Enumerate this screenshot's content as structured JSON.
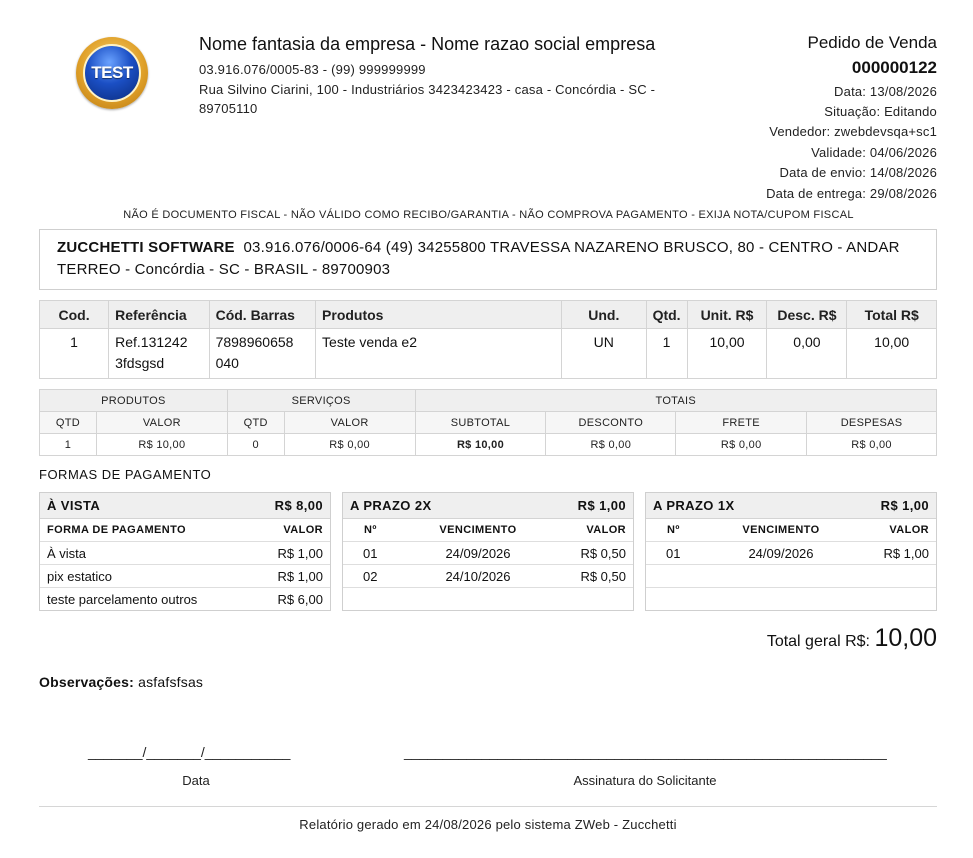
{
  "company": {
    "logo_text": "TEST",
    "name": "Nome fantasia da empresa - Nome razao social empresa",
    "doc_phone": "03.916.076/0005-83 - (99) 999999999",
    "address": "Rua Silvino Ciarini, 100 - Industriários 3423423423 - casa - Concórdia - SC - 89705110"
  },
  "order": {
    "title": "Pedido de Venda",
    "number": "000000122",
    "data": "Data: 13/08/2026",
    "situacao": "Situação: Editando",
    "vendedor": "Vendedor: zwebdevsqa+sc1",
    "validade": "Validade: 04/06/2026",
    "envio": "Data de envio: 14/08/2026",
    "entrega": "Data de entrega: 29/08/2026"
  },
  "disclaimer": "NÃO É DOCUMENTO FISCAL - NÃO VÁLIDO COMO RECIBO/GARANTIA - NÃO COMPROVA PAGAMENTO - EXIJA NOTA/CUPOM FISCAL",
  "client": {
    "name": "ZUCCHETTI SOFTWARE",
    "details": "03.916.076/0006-64  (49) 34255800  TRAVESSA NAZARENO BRUSCO, 80 - CENTRO - ANDAR TERREO - Concórdia - SC - BRASIL - 89700903"
  },
  "items": {
    "headers": [
      "Cod.",
      "Referência",
      "Cód. Barras",
      "Produtos",
      "Und.",
      "Qtd.",
      "Unit. R$",
      "Desc. R$",
      "Total R$"
    ],
    "rows": [
      [
        "1",
        "Ref.131242 3fdsgsd",
        "7898960658 040",
        "Teste venda e2",
        "UN",
        "1",
        "10,00",
        "0,00",
        "10,00"
      ]
    ]
  },
  "summary": {
    "groups": [
      "PRODUTOS",
      "SERVIÇOS",
      "TOTAIS"
    ],
    "subheaders": [
      "QTD",
      "VALOR",
      "QTD",
      "VALOR",
      "SUBTOTAL",
      "DESCONTO",
      "FRETE",
      "DESPESAS"
    ],
    "values": [
      "1",
      "R$ 10,00",
      "0",
      "R$ 0,00",
      "R$ 10,00",
      "R$ 0,00",
      "R$ 0,00",
      "R$ 0,00"
    ]
  },
  "payments": {
    "title": "FORMAS DE PAGAMENTO",
    "avista": {
      "label": "À VISTA",
      "total": "R$ 8,00",
      "col_forma": "FORMA DE PAGAMENTO",
      "col_valor": "VALOR",
      "rows": [
        {
          "forma": "À vista",
          "valor": "R$ 1,00"
        },
        {
          "forma": "pix estatico",
          "valor": "R$ 1,00"
        },
        {
          "forma": "teste parcelamento outros",
          "valor": "R$ 6,00"
        }
      ]
    },
    "prazo2": {
      "label": "A PRAZO 2X",
      "total": "R$ 1,00",
      "col_n": "Nº",
      "col_venc": "VENCIMENTO",
      "col_valor": "VALOR",
      "rows": [
        {
          "n": "01",
          "venc": "24/09/2026",
          "valor": "R$ 0,50"
        },
        {
          "n": "02",
          "venc": "24/10/2026",
          "valor": "R$ 0,50"
        }
      ]
    },
    "prazo1": {
      "label": "A PRAZO 1X",
      "total": "R$ 1,00",
      "col_n": "Nº",
      "col_venc": "VENCIMENTO",
      "col_valor": "VALOR",
      "rows": [
        {
          "n": "01",
          "venc": "24/09/2026",
          "valor": "R$ 1,00"
        }
      ]
    }
  },
  "total": {
    "label": "Total geral R$:",
    "value": "10,00"
  },
  "observations": {
    "label": "Observações:",
    "text": "asfafsfsas"
  },
  "signatures": {
    "date_line": "_______/_______/___________",
    "date_label": "Data",
    "sign_line": "______________________________________________________________",
    "sign_label": "Assinatura do Solicitante"
  },
  "footer": "Relatório gerado em 24/08/2026 pelo sistema ZWeb - Zucchetti"
}
